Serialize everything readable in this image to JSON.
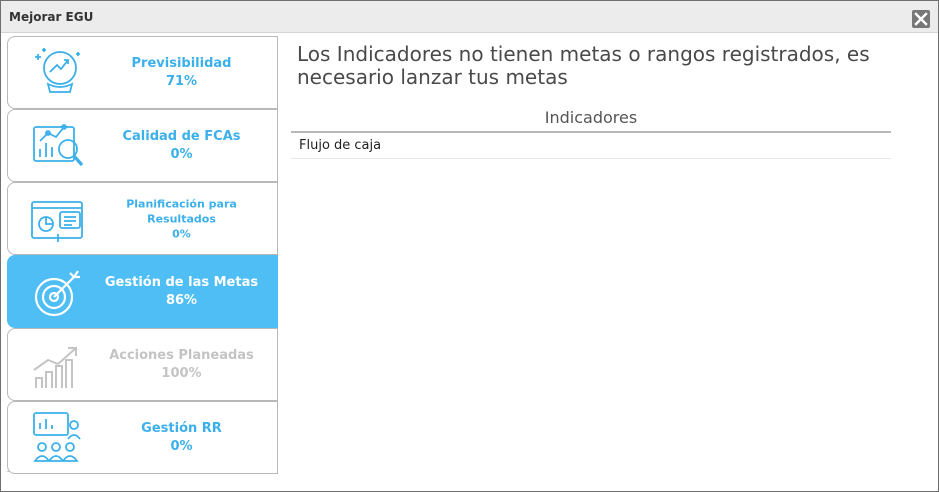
{
  "window": {
    "title": "Mejorar EGU",
    "close_icon": "close-icon"
  },
  "colors": {
    "accent": "#4fbef4",
    "accent_text": "#3bb0ea",
    "disabled": "#c4c4c4"
  },
  "sidebar": {
    "items": [
      {
        "label": "Previsibilidad",
        "percent": "71%",
        "icon": "crystal-ball-chart-icon",
        "state": "normal"
      },
      {
        "label": "Calidad de FCAs",
        "percent": "0%",
        "icon": "chart-magnifier-icon",
        "state": "normal"
      },
      {
        "label": "Planificación para Resultados",
        "percent": "0%",
        "icon": "presentation-board-icon",
        "state": "normal"
      },
      {
        "label": "Gestión de las Metas",
        "percent": "86%",
        "icon": "target-arrow-icon",
        "state": "active"
      },
      {
        "label": "Acciones Planeadas",
        "percent": "100%",
        "icon": "growth-bars-icon",
        "state": "disabled"
      },
      {
        "label": "Gestión RR",
        "percent": "0%",
        "icon": "team-meeting-icon",
        "state": "normal"
      }
    ]
  },
  "main": {
    "heading": "Los Indicadores no tienen metas o rangos registrados, es necesario lanzar tus metas",
    "table": {
      "header": "Indicadores",
      "rows": [
        "Flujo de caja"
      ]
    }
  }
}
